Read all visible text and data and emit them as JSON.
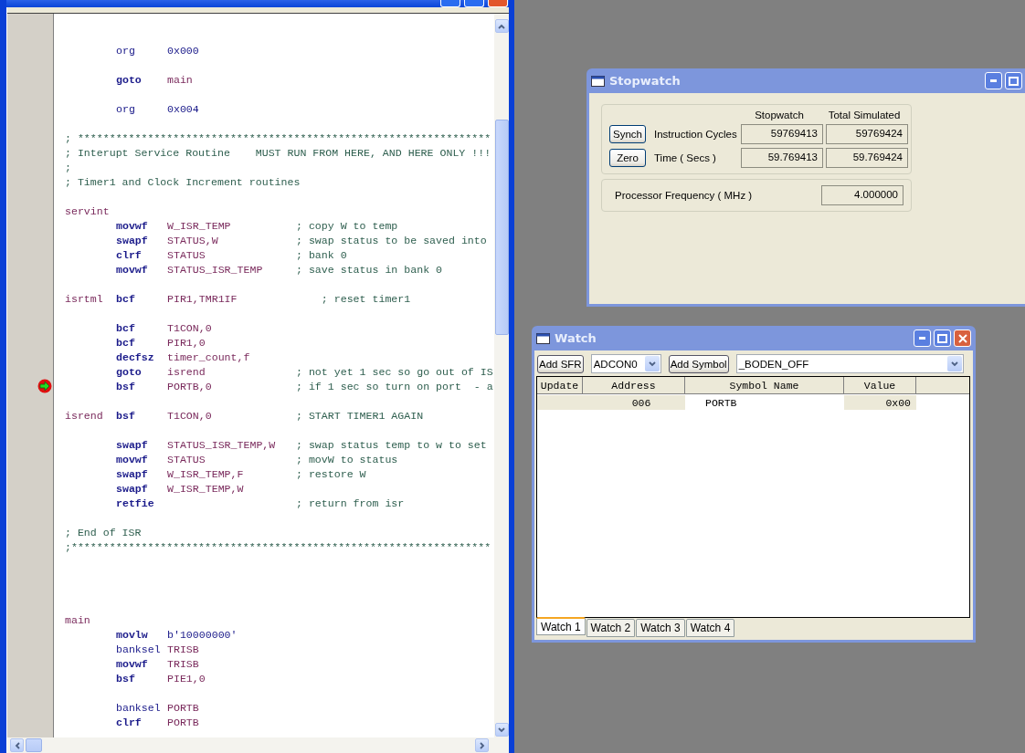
{
  "editor": {
    "lines": [
      {
        "kind": "blank"
      },
      {
        "kind": "blank"
      },
      {
        "kind": "code",
        "current": false,
        "parts": [
          {
            "kind": "directive",
            "text": "org"
          },
          {
            "kind": "number",
            "text": "0x000"
          }
        ]
      },
      {
        "kind": "blank"
      },
      {
        "kind": "code",
        "current": false,
        "parts": [
          {
            "kind": "instruction",
            "text": "goto"
          },
          {
            "kind": "operand",
            "text": "main"
          }
        ]
      },
      {
        "kind": "blank"
      },
      {
        "kind": "code",
        "current": false,
        "parts": [
          {
            "kind": "directive",
            "text": "org"
          },
          {
            "kind": "number",
            "text": "0x004"
          }
        ]
      },
      {
        "kind": "blank"
      },
      {
        "kind": "code",
        "current": false,
        "parts": [
          {
            "kind": "comment",
            "text": "; *****************************************************************"
          }
        ]
      },
      {
        "kind": "code",
        "current": false,
        "parts": [
          {
            "kind": "comment",
            "text": "; Interupt Service Routine    MUST RUN FROM HERE, AND HERE ONLY !!!"
          }
        ]
      },
      {
        "kind": "code",
        "current": false,
        "parts": [
          {
            "kind": "comment",
            "text": ";"
          }
        ]
      },
      {
        "kind": "code",
        "current": false,
        "parts": [
          {
            "kind": "comment",
            "text": "; Timer1 and Clock Increment routines"
          }
        ]
      },
      {
        "kind": "blank"
      },
      {
        "kind": "code",
        "current": false,
        "parts": [
          {
            "kind": "label",
            "text": "servint"
          }
        ]
      },
      {
        "kind": "code",
        "current": false,
        "parts": [
          {
            "kind": "instruction",
            "text": "movwf"
          },
          {
            "kind": "operand",
            "text": "W_ISR_TEMP"
          },
          {
            "kind": "comment",
            "text": "; copy W to temp"
          }
        ]
      },
      {
        "kind": "code",
        "current": false,
        "parts": [
          {
            "kind": "instruction",
            "text": "swapf"
          },
          {
            "kind": "operand",
            "text": "STATUS,W"
          },
          {
            "kind": "comment",
            "text": "; swap status to be saved into"
          }
        ]
      },
      {
        "kind": "code",
        "current": false,
        "parts": [
          {
            "kind": "instruction",
            "text": "clrf"
          },
          {
            "kind": "operand",
            "text": "STATUS"
          },
          {
            "kind": "comment",
            "text": "; bank 0"
          }
        ]
      },
      {
        "kind": "code",
        "current": false,
        "parts": [
          {
            "kind": "instruction",
            "text": "movwf"
          },
          {
            "kind": "operand",
            "text": "STATUS_ISR_TEMP"
          },
          {
            "kind": "comment",
            "text": "; save status in bank 0"
          }
        ]
      },
      {
        "kind": "blank"
      },
      {
        "kind": "code",
        "current": false,
        "parts": [
          {
            "kind": "label",
            "text": "isrtml"
          },
          {
            "kind": "instruction",
            "text": "bcf"
          },
          {
            "kind": "operand",
            "text": "PIR1,TMR1IF"
          },
          {
            "kind": "comment",
            "text": "    ; reset timer1"
          }
        ]
      },
      {
        "kind": "blank"
      },
      {
        "kind": "code",
        "current": false,
        "parts": [
          {
            "kind": "instruction",
            "text": "bcf"
          },
          {
            "kind": "operand",
            "text": "T1CON,0"
          }
        ]
      },
      {
        "kind": "code",
        "current": false,
        "parts": [
          {
            "kind": "instruction",
            "text": "bcf"
          },
          {
            "kind": "operand",
            "text": "PIR1,0"
          }
        ]
      },
      {
        "kind": "code",
        "current": false,
        "parts": [
          {
            "kind": "instruction",
            "text": "decfsz"
          },
          {
            "kind": "operand",
            "text": "timer_count,f"
          }
        ]
      },
      {
        "kind": "code",
        "current": false,
        "parts": [
          {
            "kind": "instruction",
            "text": "goto"
          },
          {
            "kind": "operand",
            "text": "isrend"
          },
          {
            "kind": "comment",
            "text": "; not yet 1 sec so go out of IS"
          }
        ]
      },
      {
        "kind": "code",
        "current": true,
        "parts": [
          {
            "kind": "instruction",
            "text": "bsf"
          },
          {
            "kind": "operand",
            "text": "PORTB,0"
          },
          {
            "kind": "comment",
            "text": "; if 1 sec so turn on port  - a"
          }
        ]
      },
      {
        "kind": "blank"
      },
      {
        "kind": "code",
        "current": false,
        "parts": [
          {
            "kind": "label",
            "text": "isrend"
          },
          {
            "kind": "instruction",
            "text": "bsf"
          },
          {
            "kind": "operand",
            "text": "T1CON,0"
          },
          {
            "kind": "comment",
            "text": "; START TIMER1 AGAIN"
          }
        ]
      },
      {
        "kind": "blank"
      },
      {
        "kind": "code",
        "current": false,
        "parts": [
          {
            "kind": "instruction",
            "text": "swapf"
          },
          {
            "kind": "operand",
            "text": "STATUS_ISR_TEMP,W"
          },
          {
            "kind": "comment",
            "text": "; swap status temp to w to set"
          }
        ]
      },
      {
        "kind": "code",
        "current": false,
        "parts": [
          {
            "kind": "instruction",
            "text": "movwf"
          },
          {
            "kind": "operand",
            "text": "STATUS"
          },
          {
            "kind": "comment",
            "text": "; movW to status"
          }
        ]
      },
      {
        "kind": "code",
        "current": false,
        "parts": [
          {
            "kind": "instruction",
            "text": "swapf"
          },
          {
            "kind": "operand",
            "text": "W_ISR_TEMP,F"
          },
          {
            "kind": "comment",
            "text": "; restore W"
          }
        ]
      },
      {
        "kind": "code",
        "current": false,
        "parts": [
          {
            "kind": "instruction",
            "text": "swapf"
          },
          {
            "kind": "operand",
            "text": "W_ISR_TEMP,W"
          }
        ]
      },
      {
        "kind": "code",
        "current": false,
        "parts": [
          {
            "kind": "instruction",
            "text": "retfie"
          },
          {
            "kind": "comment",
            "text": "; return from isr"
          }
        ]
      },
      {
        "kind": "blank"
      },
      {
        "kind": "code",
        "current": false,
        "parts": [
          {
            "kind": "comment",
            "text": "; End of ISR"
          }
        ]
      },
      {
        "kind": "code",
        "current": false,
        "parts": [
          {
            "kind": "comment",
            "text": ";******************************************************************"
          }
        ]
      },
      {
        "kind": "blank"
      },
      {
        "kind": "blank"
      },
      {
        "kind": "blank"
      },
      {
        "kind": "blank"
      },
      {
        "kind": "code",
        "current": false,
        "parts": [
          {
            "kind": "label",
            "text": "main"
          }
        ]
      },
      {
        "kind": "code",
        "current": false,
        "parts": [
          {
            "kind": "instruction",
            "text": "movlw"
          },
          {
            "kind": "number",
            "text": "b'10000000'"
          }
        ]
      },
      {
        "kind": "code",
        "current": false,
        "parts": [
          {
            "kind": "directive",
            "text": "banksel"
          },
          {
            "kind": "operand",
            "text": "TRISB"
          }
        ]
      },
      {
        "kind": "code",
        "current": false,
        "parts": [
          {
            "kind": "instruction",
            "text": "movwf"
          },
          {
            "kind": "operand",
            "text": "TRISB"
          }
        ]
      },
      {
        "kind": "code",
        "current": false,
        "parts": [
          {
            "kind": "instruction",
            "text": "bsf"
          },
          {
            "kind": "operand",
            "text": "PIE1,0"
          }
        ]
      },
      {
        "kind": "blank"
      },
      {
        "kind": "code",
        "current": false,
        "parts": [
          {
            "kind": "directive",
            "text": "banksel"
          },
          {
            "kind": "operand",
            "text": "PORTB"
          }
        ]
      },
      {
        "kind": "code",
        "current": false,
        "parts": [
          {
            "kind": "instruction",
            "text": "clrf"
          },
          {
            "kind": "operand",
            "text": "PORTB"
          }
        ]
      }
    ]
  },
  "stopwatch": {
    "title": "Stopwatch",
    "columns": [
      "Stopwatch",
      "Total Simulated"
    ],
    "rows": [
      {
        "button": "Synch",
        "label": "Instruction  Cycles",
        "values": [
          "59769413",
          "59769424"
        ]
      },
      {
        "button": "Zero",
        "label": "Time    ( Secs )",
        "values": [
          "59.769413",
          "59.769424"
        ]
      }
    ],
    "frequency": {
      "label": "Processor Frequency    ( MHz )",
      "value": "4.000000"
    }
  },
  "watch": {
    "title": "Watch",
    "add_sfr": "Add SFR",
    "sfr_select": "ADCON0",
    "add_symbol": "Add Symbol",
    "symbol_select": "_BODEN_OFF",
    "columns": [
      "Update",
      "Address",
      "Symbol Name",
      "Value"
    ],
    "rows": [
      {
        "address": "006",
        "symbol": "PORTB",
        "value": "0x00"
      }
    ],
    "tabs": [
      {
        "label": "Watch 1",
        "selected": true
      },
      {
        "label": "Watch 2",
        "selected": false
      },
      {
        "label": "Watch 3",
        "selected": false
      },
      {
        "label": "Watch 4",
        "selected": false
      }
    ]
  }
}
